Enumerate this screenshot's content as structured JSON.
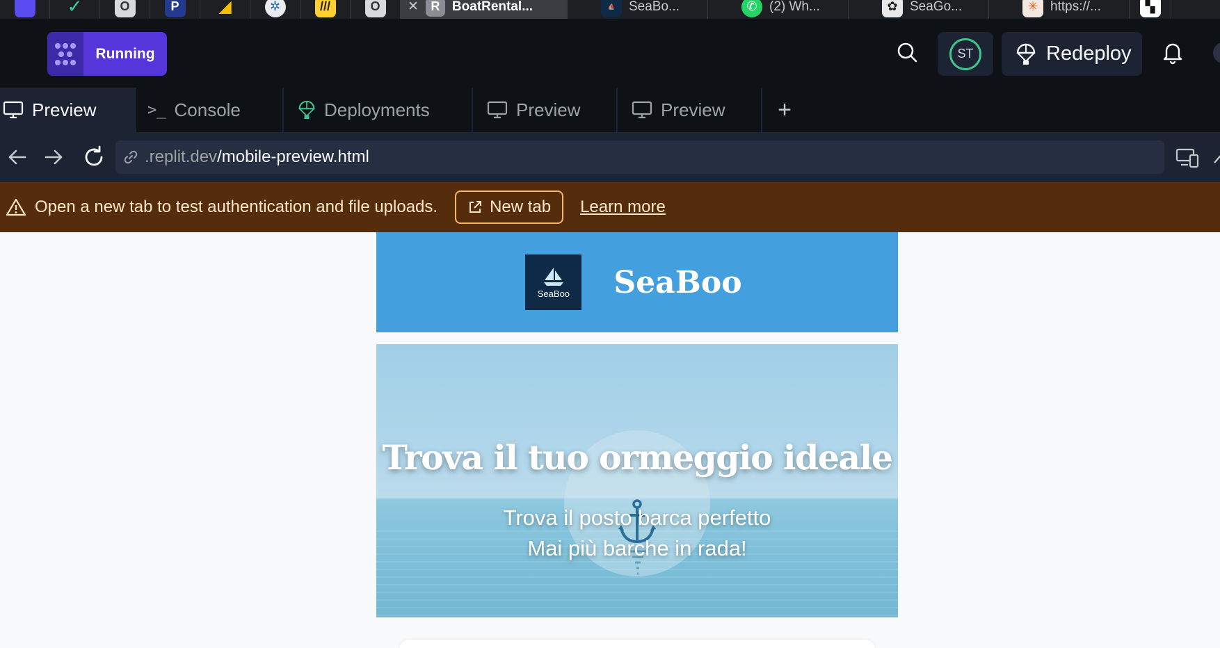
{
  "browser_tabs": {
    "favicons": [
      {
        "name": "figma-icon",
        "color": "#5b4cf0",
        "glyph": ""
      },
      {
        "name": "vercel-icon",
        "color": "#1e1f22",
        "glyph": ""
      },
      {
        "name": "o-app-icon",
        "color": "#d7dadd",
        "glyph": "O"
      },
      {
        "name": "p-app-icon",
        "color": "#233a8f",
        "glyph": "P"
      },
      {
        "name": "google-ads-icon",
        "color": "#1e1f22",
        "glyph": ""
      },
      {
        "name": "compass-icon",
        "color": "#e9ecef",
        "glyph": ""
      },
      {
        "name": "miro-icon",
        "color": "#ffd02f",
        "glyph": ""
      },
      {
        "name": "o-app-icon-2",
        "color": "#d7dadd",
        "glyph": "O"
      }
    ],
    "active": {
      "title": "BoatRental...",
      "favicon_letter": "R"
    },
    "others": [
      {
        "title": "SeaBo...",
        "icon": "seaboo-icon"
      },
      {
        "title": "(2) Wh...",
        "icon": "whatsapp-icon"
      },
      {
        "title": "SeaGo...",
        "icon": "chatgpt-icon"
      },
      {
        "title": "https://...",
        "icon": "claude-icon"
      }
    ]
  },
  "topbar": {
    "run_label": "Running",
    "avatar_initials": "ST",
    "redeploy_label": "Redeploy"
  },
  "pane_tabs": [
    {
      "label": "Preview",
      "icon": "monitor-icon",
      "active": true
    },
    {
      "label": "Console",
      "icon": "terminal-icon",
      "active": false
    },
    {
      "label": "Deployments",
      "icon": "deploy-icon",
      "active": false
    },
    {
      "label": "Preview",
      "icon": "monitor-icon",
      "active": false
    },
    {
      "label": "Preview",
      "icon": "monitor-icon",
      "active": false
    }
  ],
  "pane_add_label": "+",
  "address": {
    "url_muted": ".replit.dev",
    "url_path": "/mobile-preview.html"
  },
  "banner": {
    "message": "Open a new tab to test authentication and file uploads.",
    "new_tab_label": "New tab",
    "learn_more_label": "Learn more"
  },
  "site": {
    "logo_text": "SeaBoo",
    "title": "SeaBoo",
    "hero_title": "Trova il tuo ormeggio ideale",
    "hero_line1": "Trova il posto barca perfetto",
    "hero_line2": "Mai più barche in rada!"
  },
  "colors": {
    "accent": "#5436da",
    "banner_bg": "#552d0d",
    "site_header": "#449fde"
  }
}
